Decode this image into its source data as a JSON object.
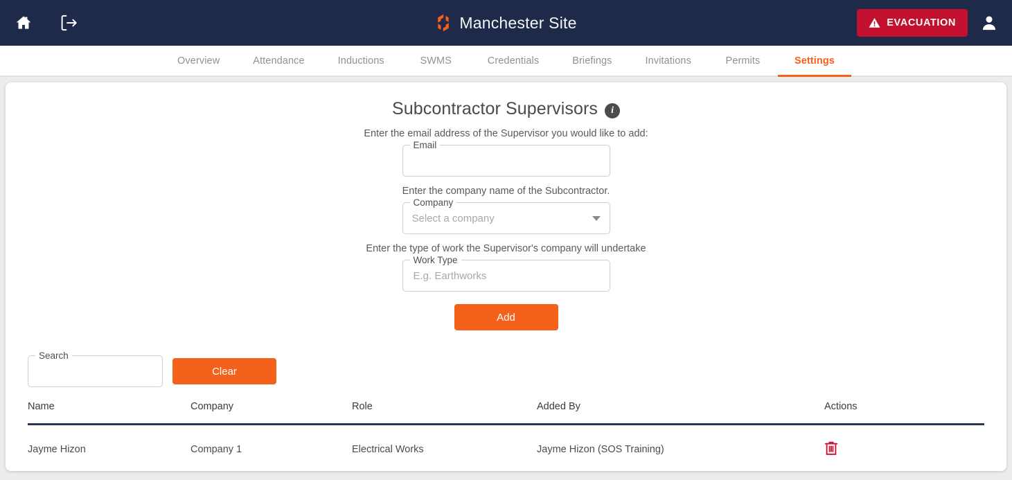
{
  "header": {
    "home_icon": "home-icon",
    "logout_icon": "logout-icon",
    "brand_title": "Manchester Site",
    "brand_logo_icon": "brand-logo-icon",
    "evacuation_label": "EVACUATION",
    "evacuation_icon": "warning-triangle-icon",
    "user_icon": "user-account-icon",
    "colors": {
      "bar_background": "#1f2a4a",
      "evacuation_red": "#c4102f",
      "brand_orange": "#f4611a"
    }
  },
  "tabs": [
    {
      "label": "Overview",
      "active": false
    },
    {
      "label": "Attendance",
      "active": false
    },
    {
      "label": "Inductions",
      "active": false
    },
    {
      "label": "SWMS",
      "active": false
    },
    {
      "label": "Credentials",
      "active": false
    },
    {
      "label": "Briefings",
      "active": false
    },
    {
      "label": "Invitations",
      "active": false
    },
    {
      "label": "Permits",
      "active": false
    },
    {
      "label": "Settings",
      "active": true
    }
  ],
  "main": {
    "page_title": "Subcontractor Supervisors",
    "info_icon": "info-icon",
    "info_glyph": "i",
    "helper_email": "Enter the email address of the Supervisor you would like to add:",
    "helper_company": "Enter the company name of the Subcontractor.",
    "helper_worktype": "Enter the type of work the Supervisor's company will undertake",
    "email_field": {
      "label": "Email",
      "value": "",
      "placeholder": ""
    },
    "company_field": {
      "label": "Company",
      "selected": "Select a company",
      "caret_icon": "chevron-down-icon"
    },
    "work_type_field": {
      "label": "Work Type",
      "value": "",
      "placeholder": "E.g. Earthworks"
    },
    "add_button": "Add",
    "search_field": {
      "label": "Search",
      "value": "",
      "placeholder": ""
    },
    "clear_button": "Clear"
  },
  "table": {
    "columns": [
      "Name",
      "Company",
      "Role",
      "Added By",
      "Actions"
    ],
    "rows": [
      {
        "name": "Jayme Hizon",
        "company": "Company 1",
        "role": "Electrical Works",
        "added_by": "Jayme Hizon (SOS Training)",
        "action_icon": "delete-trash-icon"
      }
    ]
  }
}
